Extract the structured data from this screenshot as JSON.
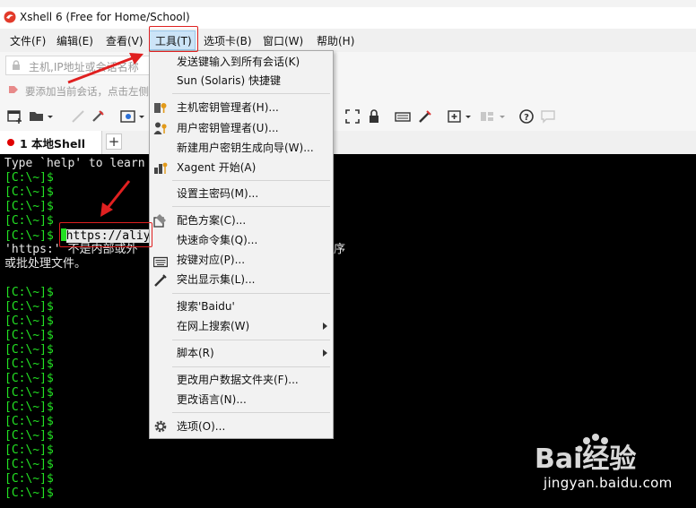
{
  "window": {
    "title": "Xshell 6 (Free for Home/School)"
  },
  "menubar": {
    "items": [
      {
        "label": "文件(F)"
      },
      {
        "label": "编辑(E)"
      },
      {
        "label": "查看(V)"
      },
      {
        "label": "工具(T)"
      },
      {
        "label": "选项卡(B)"
      },
      {
        "label": "窗口(W)"
      },
      {
        "label": "帮助(H)"
      }
    ]
  },
  "address_bar": {
    "placeholder": "主机,IP地址或会话名称"
  },
  "hint_bar": {
    "text": "要添加当前会话，点击左侧"
  },
  "tabs": [
    {
      "label": "1 本地Shell",
      "status_color": "#e00000"
    }
  ],
  "terminal": {
    "intro": "Type `help' to learn",
    "prompt": "[C:\\~]$ ",
    "typed_url": "https://aliy",
    "error_line1": "'https:' 不是内部或外",
    "error_line1_tail": "序",
    "error_line2": "或批处理文件。",
    "colors": {
      "prompt": "#23e123",
      "text": "#e8e8e8",
      "background": "#000000"
    }
  },
  "tools_menu": {
    "items": [
      {
        "label": "发送键输入到所有会话(K)",
        "icon": "none"
      },
      {
        "label": "Sun (Solaris) 快捷键",
        "icon": "none"
      },
      {
        "label": "主机密钥管理者(H)...",
        "icon": "host-key-icon"
      },
      {
        "label": "用户密钥管理者(U)...",
        "icon": "user-key-icon"
      },
      {
        "label": "新建用户密钥生成向导(W)...",
        "icon": "none"
      },
      {
        "label": "Xagent 开始(A)",
        "icon": "xagent-icon"
      },
      {
        "label": "设置主密码(M)...",
        "icon": "none"
      },
      {
        "label": "配色方案(C)...",
        "icon": "color-scheme-icon"
      },
      {
        "label": "快速命令集(Q)...",
        "icon": "none"
      },
      {
        "label": "按键对应(P)...",
        "icon": "keyboard-icon"
      },
      {
        "label": "突出显示集(L)...",
        "icon": "highlight-icon"
      },
      {
        "label": "搜索'Baidu'",
        "icon": "none"
      },
      {
        "label": "在网上搜索(W)",
        "icon": "none",
        "submenu": true
      },
      {
        "label": "脚本(R)",
        "icon": "none",
        "submenu": true
      },
      {
        "label": "更改用户数据文件夹(F)...",
        "icon": "none"
      },
      {
        "label": "更改语言(N)...",
        "icon": "none"
      },
      {
        "label": "选项(O)...",
        "icon": "gear-icon"
      }
    ]
  },
  "watermark": {
    "brand": "Bai经验",
    "site": "jingyan.baidu.com"
  },
  "accent_colors": {
    "menu_active": "#cce4f7",
    "annotation": "#e02020"
  }
}
